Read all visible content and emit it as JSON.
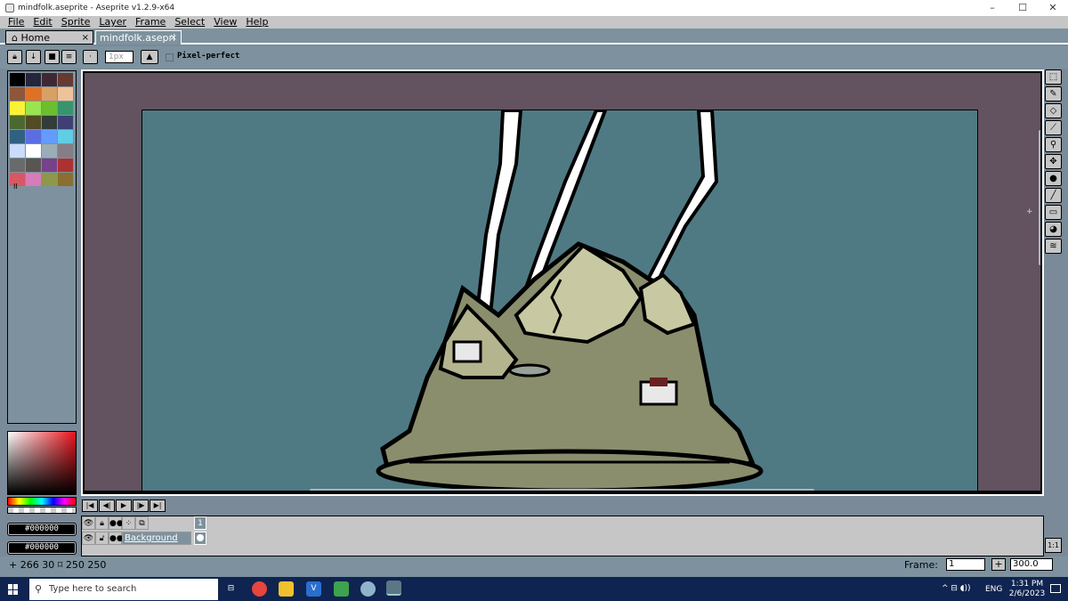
{
  "window": {
    "title": "mindfolk.aseprite - Aseprite v1.2.9-x64",
    "minimize": "–",
    "maximize": "☐",
    "close": "✕"
  },
  "menu": [
    "File",
    "Edit",
    "Sprite",
    "Layer",
    "Frame",
    "Select",
    "View",
    "Help"
  ],
  "tabs": {
    "home": "Home",
    "file": "mindfolk.asepri",
    "close": "×"
  },
  "context_bar": {
    "brush_size": "1px",
    "pixel_perfect_label": "Pixel-perfect"
  },
  "palette": {
    "swatches": [
      "#000000",
      "#25253c",
      "#3f2832",
      "#663931",
      "#8f563b",
      "#df7126",
      "#d9a066",
      "#eec39a",
      "#fbf236",
      "#99e550",
      "#6abe30",
      "#37946e",
      "#4b692f",
      "#524b24",
      "#323c39",
      "#3f3f74",
      "#306082",
      "#5b6ee1",
      "#639bff",
      "#5fcde4",
      "#cbdbfc",
      "#ffffff",
      "#9badb7",
      "#847e87",
      "#696a6a",
      "#595652",
      "#76428a",
      "#ac3232",
      "#d95763",
      "#d77bba",
      "#8f974a",
      "#8a6f30"
    ],
    "more_label": "II"
  },
  "colors": {
    "foreground": "#000000",
    "background": "#000000"
  },
  "timeline": {
    "frame_number": "1",
    "layer_name": "Background"
  },
  "status": {
    "position": "+ 266 30",
    "size": "250 250",
    "frame_label": "Frame:",
    "frame_value": "1",
    "zoom_value": "300.0"
  },
  "taskbar": {
    "search_placeholder": "Type here to search",
    "language": "ENG",
    "time": "1:31 PM",
    "date": "2/6/2023"
  },
  "accent": {
    "panel": "#7d929e",
    "button_face": "#c6c6c6",
    "canvas_bg": "#63525f",
    "sprite_bg": "#4f7a84"
  }
}
